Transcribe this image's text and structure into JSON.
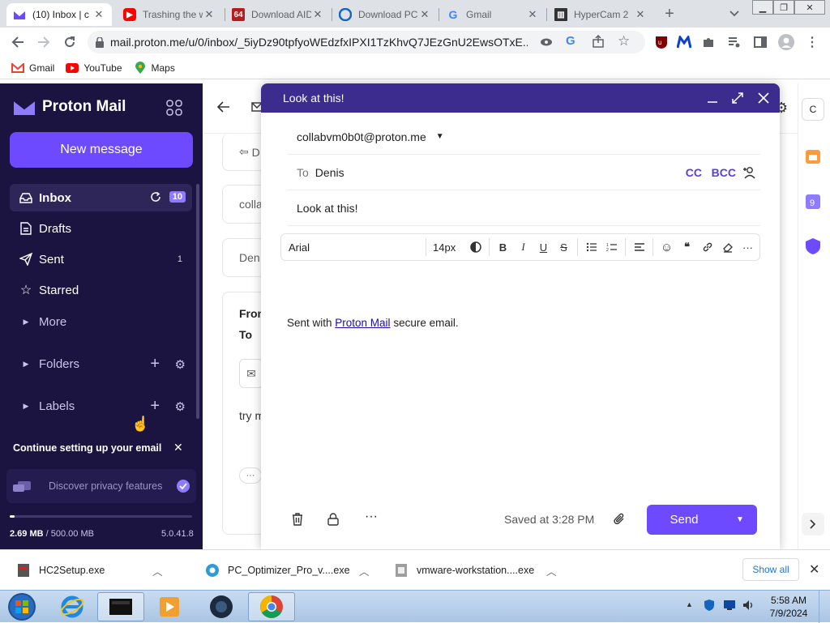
{
  "browser": {
    "tabs": [
      {
        "title": "(10) Inbox | c",
        "active": true,
        "favicon": "proton-mail-icon"
      },
      {
        "title": "Trashing the w",
        "active": false,
        "favicon": "youtube-icon"
      },
      {
        "title": "Download AID",
        "active": false,
        "favicon": "aida64-icon"
      },
      {
        "title": "Download PC",
        "active": false,
        "favicon": "download-icon"
      },
      {
        "title": "Gmail",
        "active": false,
        "favicon": "google-icon"
      },
      {
        "title": "HyperCam 2",
        "active": false,
        "favicon": "hypercam-icon"
      }
    ],
    "url": "mail.proton.me/u/0/inbox/_5iyDz90tpfyoWEdzfxIPXI1TzKhvQ7JEzGnU2EwsOTxE...",
    "bookmarks": [
      {
        "label": "Gmail",
        "icon": "gmail-icon"
      },
      {
        "label": "YouTube",
        "icon": "youtube-icon"
      },
      {
        "label": "Maps",
        "icon": "maps-icon"
      }
    ]
  },
  "sidebar": {
    "logo": "Proton Mail",
    "new_message": "New message",
    "items": [
      {
        "label": "Inbox",
        "icon": "inbox-icon",
        "badge": "10"
      },
      {
        "label": "Drafts",
        "icon": "drafts-icon"
      },
      {
        "label": "Sent",
        "icon": "sent-icon",
        "count": "1"
      },
      {
        "label": "Starred",
        "icon": "star-icon"
      },
      {
        "label": "More",
        "icon": "caret-right-icon"
      }
    ],
    "folders": "Folders",
    "labels": "Labels",
    "setup_title": "Continue setting up your email",
    "setup_item": "Discover privacy features",
    "storage_used": "2.69 MB",
    "storage_total": "/ 500.00 MB",
    "storage_fraction": 0.0054,
    "version": "5.0.41.8"
  },
  "background": {
    "reply": "D",
    "card1": "colla",
    "card2": "Den",
    "from_label": "Fron",
    "to_label": "To",
    "body_snippet": "try m",
    "more": "···"
  },
  "composer": {
    "title": "Look at this!",
    "from": "collabvm0b0t@proton.me",
    "to_label": "To",
    "to_value": "Denis",
    "cc": "CC",
    "bcc": "BCC",
    "subject": "Look at this!",
    "font": "Arial",
    "size": "14px",
    "body_prefix": "Sent with ",
    "body_link": "Proton Mail",
    "body_suffix": " secure email.",
    "saved": "Saved at 3:28 PM",
    "send": "Send"
  },
  "downloads": {
    "files": [
      {
        "name": "HC2Setup.exe"
      },
      {
        "name": "PC_Optimizer_Pro_v....exe"
      },
      {
        "name": "vmware-workstation....exe"
      }
    ],
    "show_all": "Show all"
  },
  "taskbar": {
    "time": "5:58 AM",
    "date": "7/9/2024"
  },
  "colors": {
    "sidebar_bg": "#1b1340",
    "accent": "#6d4aff",
    "composer_header": "#3c2c8e"
  }
}
